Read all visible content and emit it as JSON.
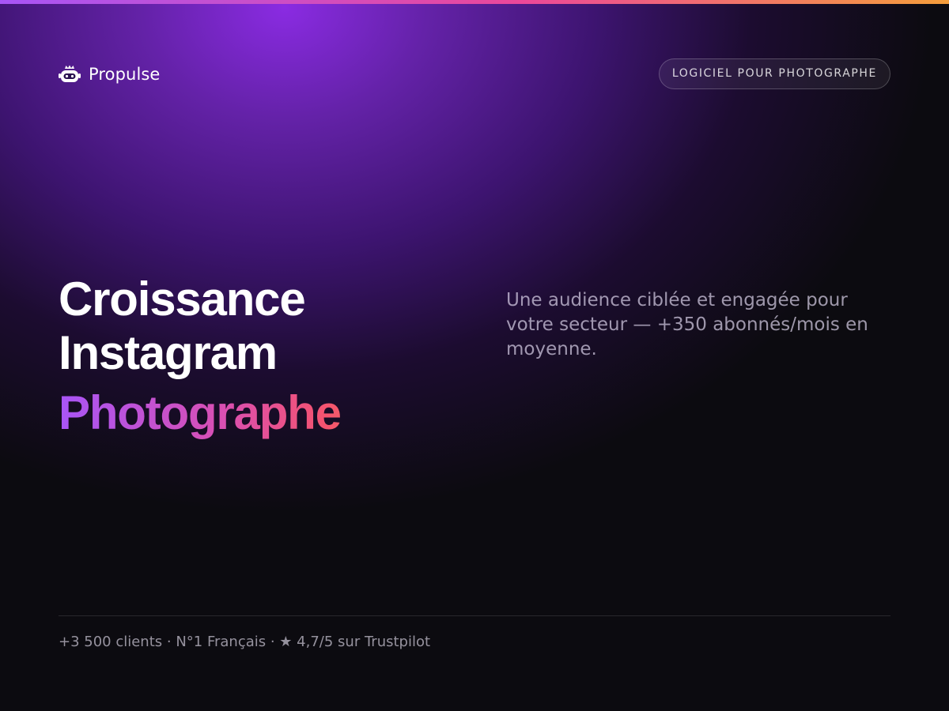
{
  "brand": {
    "name": "Propulse",
    "logo_icon": "robot-crown-icon"
  },
  "badge": {
    "label": "LOGICIEL POUR PHOTOGRAPHE"
  },
  "hero": {
    "title_line1": "Croissance",
    "title_line2": "Instagram",
    "title_accent": "Photographe",
    "description": "Une audience ciblée et engagée pour votre secteur — +350 abonnés/mois en moyenne."
  },
  "footer": {
    "stats": "+3 500 clients · N°1 Français · ★ 4,7/5 sur Trustpilot"
  },
  "colors": {
    "background": "#0c0b10",
    "glow": "#8a2be2",
    "accent_gradient": [
      "#a855f7",
      "#ec4899",
      "#f59e3b"
    ],
    "text_primary": "#ffffff"
  }
}
